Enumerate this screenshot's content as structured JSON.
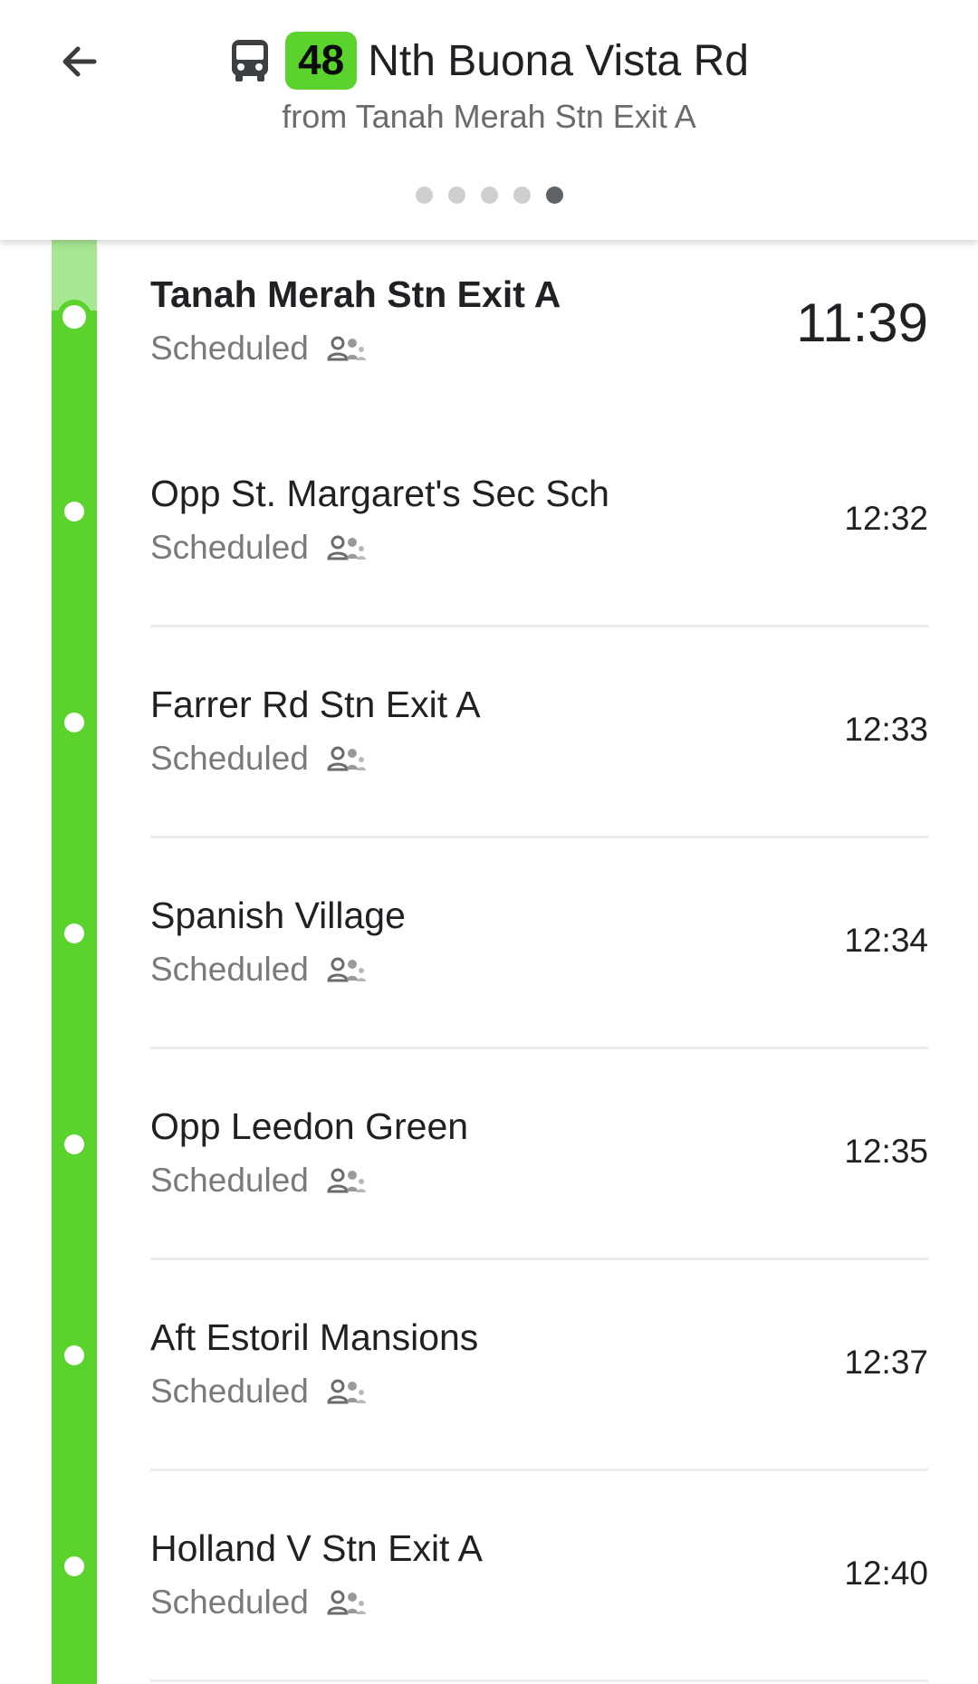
{
  "header": {
    "route_number": "48",
    "destination": "Nth Buona Vista Rd",
    "subtitle": "from Tanah Merah Stn Exit A",
    "page_count": 5,
    "active_page": 5
  },
  "colors": {
    "accent": "#5ad32c",
    "accent_faded": "#a8e793"
  },
  "stops": [
    {
      "name": "Tanah Merah Stn Exit A",
      "status": "Scheduled",
      "time": "11:39"
    },
    {
      "name": "Opp St. Margaret's Sec Sch",
      "status": "Scheduled",
      "time": "12:32"
    },
    {
      "name": "Farrer Rd Stn Exit A",
      "status": "Scheduled",
      "time": "12:33"
    },
    {
      "name": "Spanish Village",
      "status": "Scheduled",
      "time": "12:34"
    },
    {
      "name": "Opp Leedon Green",
      "status": "Scheduled",
      "time": "12:35"
    },
    {
      "name": "Aft Estoril Mansions",
      "status": "Scheduled",
      "time": "12:37"
    },
    {
      "name": "Holland V Stn Exit A",
      "status": "Scheduled",
      "time": "12:40"
    }
  ]
}
